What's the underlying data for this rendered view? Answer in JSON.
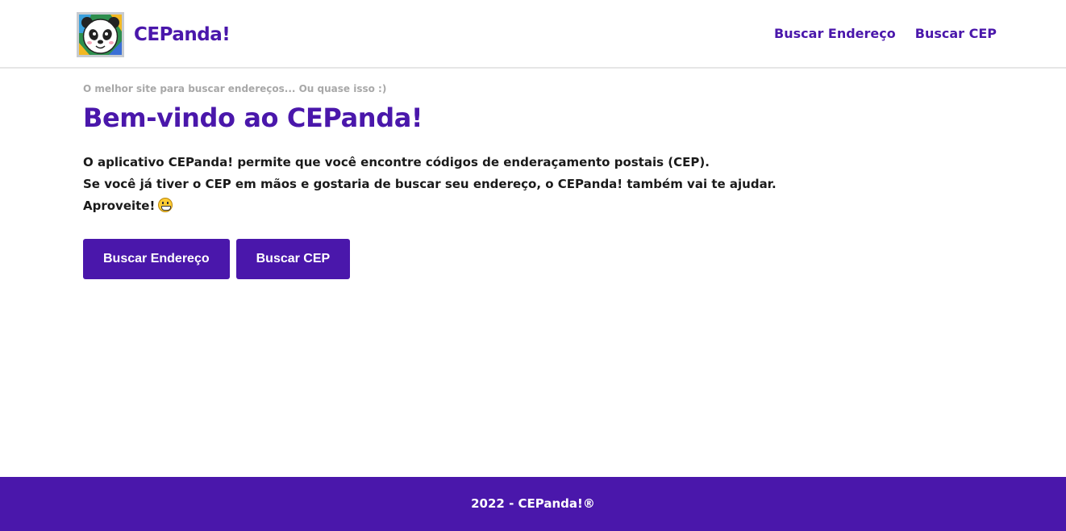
{
  "header": {
    "brand_name": "CEPanda!",
    "logo_icon": "panda-map-logo-icon",
    "nav": [
      {
        "label": "Buscar Endereço"
      },
      {
        "label": "Buscar CEP"
      }
    ]
  },
  "main": {
    "tagline": "O melhor site para buscar endereços... Ou quase isso :)",
    "title": "Bem-vindo ao CEPanda!",
    "paragraphs": [
      "O aplicativo CEPanda! permite que você encontre códigos de enderaçamento postais (CEP).",
      "Se você já tiver o CEP em mãos e gostaria de buscar seu endereço, o CEPanda! também vai te ajudar.",
      "Aproveite!"
    ],
    "emoji_icon": "grinning-face-icon",
    "buttons": [
      {
        "label": "Buscar Endereço"
      },
      {
        "label": "Buscar CEP"
      }
    ]
  },
  "footer": {
    "text": "2022 - CEPanda!®"
  },
  "colors": {
    "brand": "#4a17ab",
    "tagline": "#a8a8a8",
    "footer_bg": "#4a17ab"
  }
}
